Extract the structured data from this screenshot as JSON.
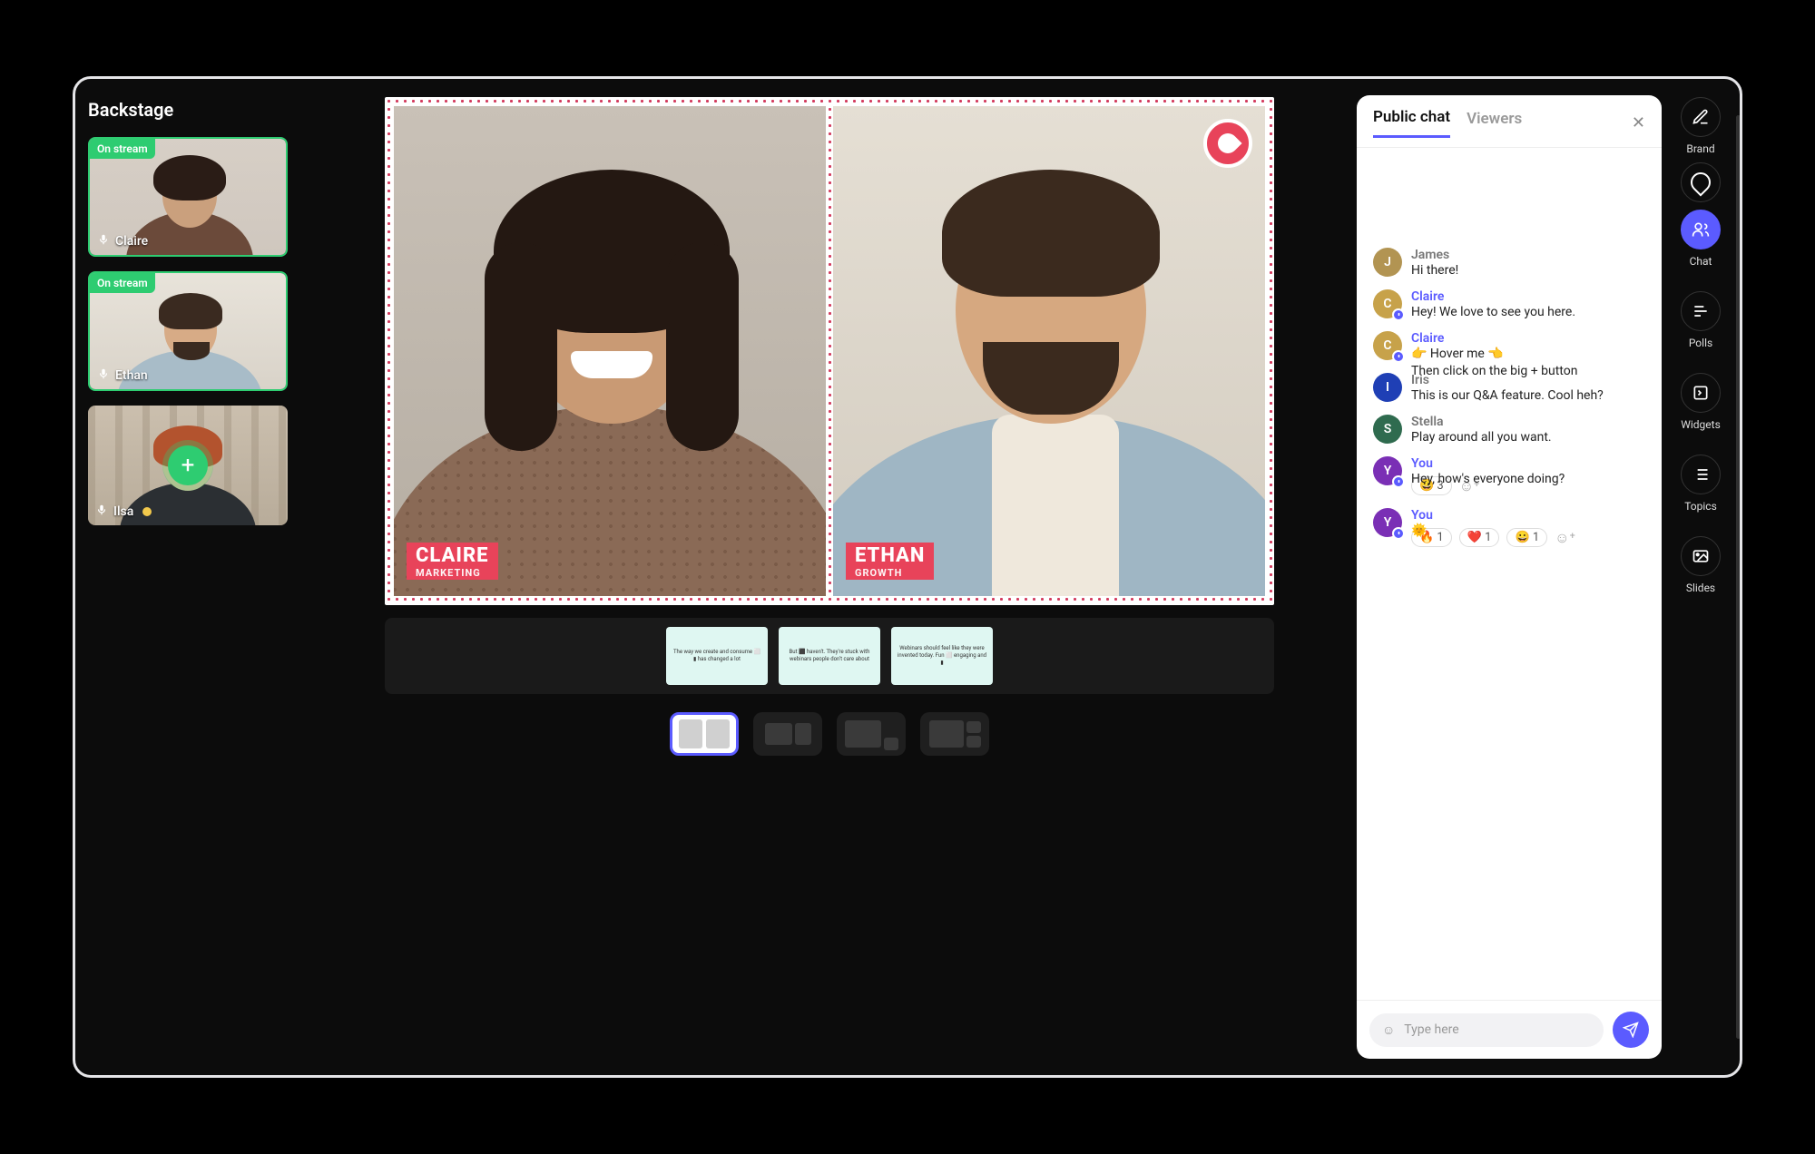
{
  "backstage": {
    "title": "Backstage",
    "on_stream_label": "On stream",
    "tiles": [
      {
        "name": "Claire",
        "on_stream": true
      },
      {
        "name": "Ethan",
        "on_stream": true
      },
      {
        "name": "Ilsa",
        "on_stream": false,
        "status": "away"
      }
    ]
  },
  "stage": {
    "feeds": [
      {
        "name": "CLAIRE",
        "role": "MARKETING"
      },
      {
        "name": "ETHAN",
        "role": "GROWTH"
      }
    ],
    "slides": [
      "The way we create and consume ⬜ ▮ has changed a lot",
      "But ⬛ haven't. They're stuck with webinars people don't care about",
      "Webinars should feel like they were invented today. Fun ⬜ engaging and ▮"
    ]
  },
  "layouts": {
    "active_index": 0
  },
  "chat": {
    "tabs": {
      "public": "Public chat",
      "viewers": "Viewers"
    },
    "close": "✕",
    "placeholder": "Type here",
    "messages": [
      {
        "author": "James",
        "initial": "J",
        "host": false,
        "color": "#b29452",
        "body": "Hi there!"
      },
      {
        "author": "Claire",
        "initial": "C",
        "host": true,
        "color": "#c7a24a",
        "badge": true,
        "body": "Hey! We love to see you here."
      },
      {
        "author": "Claire",
        "initial": "C",
        "host": true,
        "color": "#c7a24a",
        "badge": true,
        "body": "👉 Hover me 👈\nThen click on the big + button"
      },
      {
        "author": "Iris",
        "initial": "I",
        "host": false,
        "color": "#1f3fb5",
        "body": "This is our Q&A feature. Cool heh?"
      },
      {
        "author": "Stella",
        "initial": "S",
        "host": false,
        "color": "#2f6b4f",
        "body": "Play around all you want."
      },
      {
        "author": "You",
        "initial": "Y",
        "host": true,
        "color": "#7a2fb5",
        "badge": true,
        "body": "Hey, how's everyone doing?",
        "reactions": [
          {
            "e": "😀",
            "n": "3"
          }
        ]
      },
      {
        "author": "You",
        "initial": "Y",
        "host": true,
        "color": "#7a2fb5",
        "badge": true,
        "body": "🌞",
        "reactions": [
          {
            "e": "🔥",
            "n": "1"
          },
          {
            "e": "❤️",
            "n": "1"
          },
          {
            "e": "😀",
            "n": "1"
          }
        ]
      }
    ]
  },
  "rail": {
    "items": [
      {
        "key": "brand",
        "label": "Brand"
      },
      {
        "key": "speech",
        "label": ""
      },
      {
        "key": "chat",
        "label": "Chat",
        "active": true
      },
      {
        "key": "polls",
        "label": "Polls"
      },
      {
        "key": "widgets",
        "label": "Widgets"
      },
      {
        "key": "topics",
        "label": "Topics"
      },
      {
        "key": "slides",
        "label": "Slides"
      }
    ]
  },
  "colors": {
    "accent": "#5b5bff",
    "success": "#2ecc71",
    "brand": "#e8435a"
  }
}
